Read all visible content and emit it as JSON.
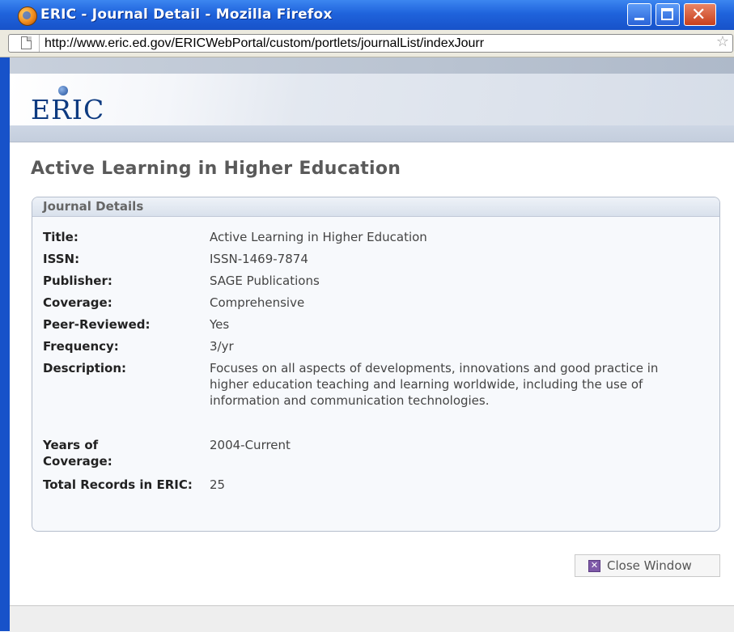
{
  "window": {
    "title": "ERIC - Journal Detail - Mozilla Firefox",
    "icon": "firefox-icon",
    "controls": {
      "minimize_icon": "minimize-icon",
      "maximize_icon": "maximize-icon",
      "close_icon": "close-icon",
      "close_glyph": "✕"
    }
  },
  "address_bar": {
    "url": "http://www.eric.ed.gov/ERICWebPortal/custom/portlets/journalList/indexJourr",
    "page_icon": "page-icon",
    "bookmark_icon": "star-icon",
    "bookmark_glyph": "☆"
  },
  "header": {
    "logo_text": "ERIC"
  },
  "page": {
    "title": "Active Learning in Higher Education"
  },
  "journal_details": {
    "heading": "Journal Details",
    "fields": [
      {
        "label": "Title:",
        "value": "Active Learning in Higher Education"
      },
      {
        "label": "ISSN:",
        "value": "ISSN-1469-7874"
      },
      {
        "label": "Publisher:",
        "value": "SAGE Publications"
      },
      {
        "label": "Coverage:",
        "value": "Comprehensive"
      },
      {
        "label": "Peer-Reviewed:",
        "value": "Yes"
      },
      {
        "label": "Frequency:",
        "value": "3/yr"
      },
      {
        "label": "Description:",
        "value": "Focuses on all aspects of developments, innovations and good practice in higher education teaching and learning worldwide, including the use of information and communication technologies."
      },
      {
        "label": "Years of Coverage:",
        "value": "2004-Current"
      },
      {
        "label": "Total Records in ERIC:",
        "value": "25"
      }
    ]
  },
  "actions": {
    "close_label": "Close Window",
    "close_icon": "close-window-icon",
    "close_glyph": "✕"
  },
  "colors": {
    "titlebar": "#1f63dc",
    "logo": "#0d3a80",
    "title_text": "#5a5a5a"
  }
}
